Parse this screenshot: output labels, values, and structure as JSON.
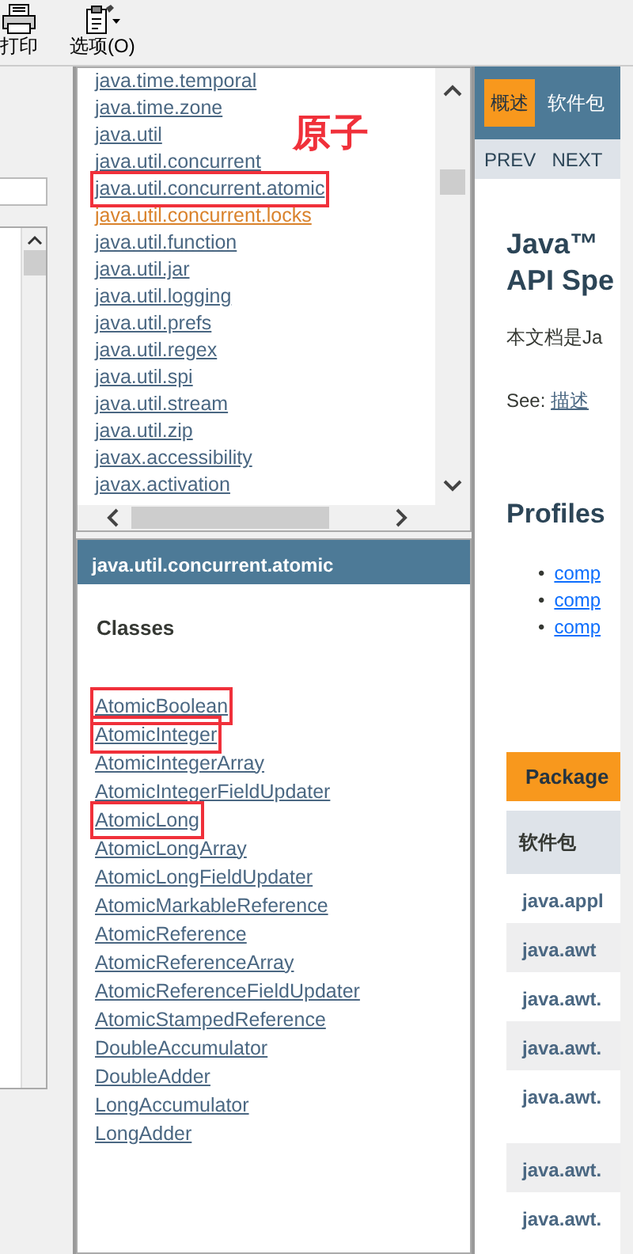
{
  "toolbar": {
    "buttons": [
      {
        "label": "打印"
      },
      {
        "label": "选项(O)"
      }
    ]
  },
  "package_list": {
    "annotation_label": "原子",
    "items": [
      {
        "label": "java.time.temporal",
        "visited": false,
        "annotated": false
      },
      {
        "label": "java.time.zone",
        "visited": false,
        "annotated": false
      },
      {
        "label": "java.util",
        "visited": false,
        "annotated": false
      },
      {
        "label": "java.util.concurrent",
        "visited": false,
        "annotated": false
      },
      {
        "label": "java.util.concurrent.atomic",
        "visited": false,
        "annotated": true
      },
      {
        "label": "java.util.concurrent.locks",
        "visited": true,
        "annotated": false
      },
      {
        "label": "java.util.function",
        "visited": false,
        "annotated": false
      },
      {
        "label": "java.util.jar",
        "visited": false,
        "annotated": false
      },
      {
        "label": "java.util.logging",
        "visited": false,
        "annotated": false
      },
      {
        "label": "java.util.prefs",
        "visited": false,
        "annotated": false
      },
      {
        "label": "java.util.regex",
        "visited": false,
        "annotated": false
      },
      {
        "label": "java.util.spi",
        "visited": false,
        "annotated": false
      },
      {
        "label": "java.util.stream",
        "visited": false,
        "annotated": false
      },
      {
        "label": "java.util.zip",
        "visited": false,
        "annotated": false
      },
      {
        "label": "javax.accessibility",
        "visited": false,
        "annotated": false
      },
      {
        "label": "javax.activation",
        "visited": false,
        "annotated": false
      }
    ]
  },
  "class_frame": {
    "header": "java.util.concurrent.atomic",
    "heading": "Classes",
    "classes": [
      {
        "label": "AtomicBoolean",
        "annotated": true
      },
      {
        "label": "AtomicInteger",
        "annotated": true
      },
      {
        "label": "AtomicIntegerArray",
        "annotated": false
      },
      {
        "label": "AtomicIntegerFieldUpdater",
        "annotated": false
      },
      {
        "label": "AtomicLong",
        "annotated": true
      },
      {
        "label": "AtomicLongArray",
        "annotated": false
      },
      {
        "label": "AtomicLongFieldUpdater",
        "annotated": false
      },
      {
        "label": "AtomicMarkableReference",
        "annotated": false
      },
      {
        "label": "AtomicReference",
        "annotated": false
      },
      {
        "label": "AtomicReferenceArray",
        "annotated": false
      },
      {
        "label": "AtomicReferenceFieldUpdater",
        "annotated": false
      },
      {
        "label": "AtomicStampedReference",
        "annotated": false
      },
      {
        "label": "DoubleAccumulator",
        "annotated": false
      },
      {
        "label": "DoubleAdder",
        "annotated": false
      },
      {
        "label": "LongAccumulator",
        "annotated": false
      },
      {
        "label": "LongAdder",
        "annotated": false
      }
    ]
  },
  "overview": {
    "tabs": [
      {
        "label": "概述",
        "selected": true
      },
      {
        "label": "软件包",
        "selected": false
      }
    ],
    "nav": [
      "PREV",
      "NEXT"
    ],
    "title_lines": [
      "Java™",
      "API Spe"
    ],
    "intro": "本文档是Ja",
    "see_label": "See:",
    "see_link": "描述",
    "profiles_heading": "Profiles",
    "profiles": [
      {
        "marker": "•",
        "label": "comp"
      },
      {
        "marker": "•",
        "label": "comp"
      },
      {
        "marker": "•",
        "label": "comp"
      }
    ],
    "table_caption": "Package",
    "table_header": "软件包",
    "rows": [
      "java.appl",
      "java.awt",
      "java.awt.",
      "java.awt.",
      "java.awt.",
      "java.awt.",
      "java.awt."
    ]
  }
}
